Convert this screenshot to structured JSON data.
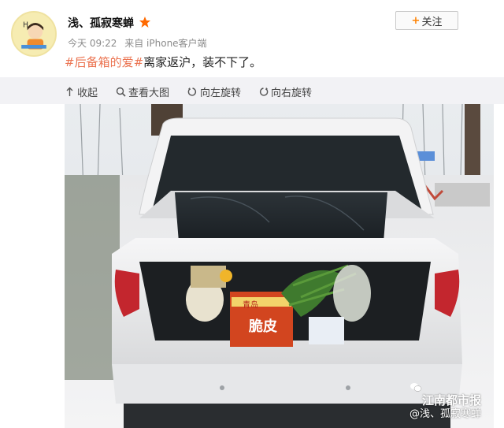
{
  "post": {
    "username": "浅、孤寂寒蝉",
    "time": "今天 09:22",
    "source": "来自 iPhone客户端",
    "follow_label": "关注",
    "hashtag": "#后备箱的爱#",
    "text": "离家返沪，装不下了。"
  },
  "toolbar": {
    "collapse": "收起",
    "view_large": "查看大图",
    "rotate_left": "向左旋转",
    "rotate_right": "向右旋转"
  },
  "watermark": {
    "brand": "江南都市报",
    "user": "@浅、孤寂寒蝉"
  },
  "photo_labels": {
    "box_brand": "青岛",
    "box_text": "脆皮"
  },
  "colors": {
    "tag": "#eb7350",
    "vip_star": "#ff6a00",
    "toolbar_bg": "#f2f2f5"
  }
}
